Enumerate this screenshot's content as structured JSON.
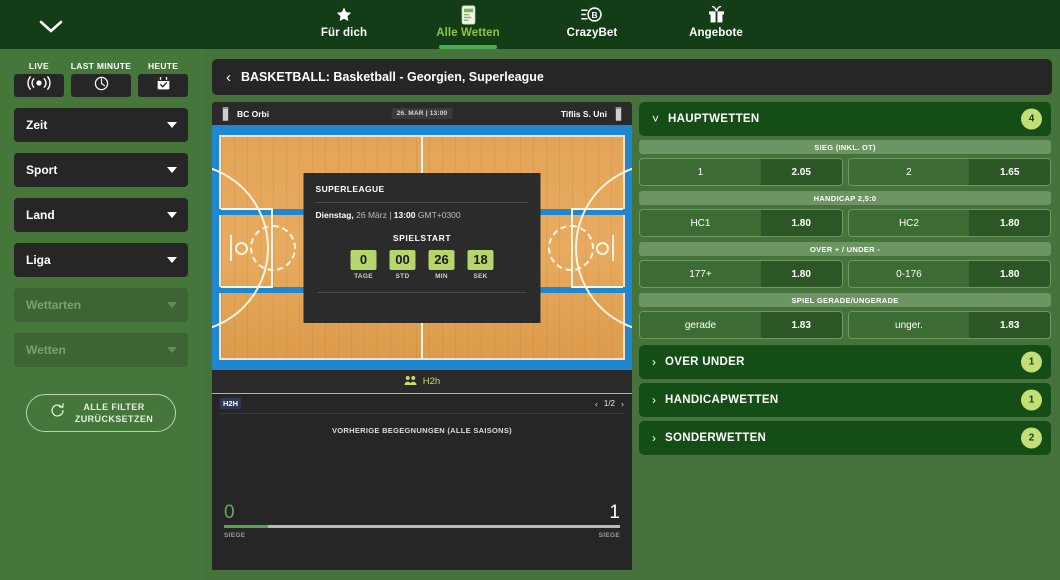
{
  "topnav": {
    "chevron_icon": "chevron-down-icon",
    "items": [
      {
        "label": "Für dich",
        "icon": "star-icon",
        "active": false
      },
      {
        "label": "Alle Wetten",
        "icon": "betslip-phone-icon",
        "active": true
      },
      {
        "label": "CrazyBet",
        "icon": "crazybet-b-icon",
        "active": false
      },
      {
        "label": "Angebote",
        "icon": "gift-icon",
        "active": false
      }
    ]
  },
  "sidebar": {
    "quick": [
      {
        "label": "LIVE",
        "icon": "live-broadcast-icon"
      },
      {
        "label": "LAST MINUTE",
        "icon": "clock-icon"
      },
      {
        "label": "HEUTE",
        "icon": "calendar-check-icon"
      }
    ],
    "filters": [
      {
        "label": "Zeit",
        "disabled": false
      },
      {
        "label": "Sport",
        "disabled": false
      },
      {
        "label": "Land",
        "disabled": false
      },
      {
        "label": "Liga",
        "disabled": false
      },
      {
        "label": "Wettarten",
        "disabled": true
      },
      {
        "label": "Wetten",
        "disabled": true
      }
    ],
    "reset": {
      "line1": "ALLE FILTER",
      "line2": "ZURÜCKSETZEN",
      "icon": "refresh-icon"
    }
  },
  "breadcrumb": {
    "back_icon": "chevron-left-icon",
    "title": "BASKETBALL: Basketball - Georgien, Superleague"
  },
  "match": {
    "home_team": "BC Orbi",
    "away_team": "Tiflis S. Uni",
    "time_badge": "26. MAR | 13:00",
    "jersey_icon": "jersey-icon"
  },
  "countdown": {
    "league": "SUPERLEAGUE",
    "date_day": "Dienstag,",
    "date_rest": " 26 März | ",
    "date_time": "13:00",
    "date_tz": " GMT+0300",
    "start_label": "SPIELSTART",
    "units": [
      {
        "value": "0",
        "label": "TAGE"
      },
      {
        "value": "00",
        "label": "STD"
      },
      {
        "value": "26",
        "label": "MIN"
      },
      {
        "value": "18",
        "label": "SEK"
      }
    ]
  },
  "h2h": {
    "tab_label": "H2h",
    "tab_icon": "people-icon",
    "tag": "H2H",
    "pager": {
      "prev_icon": "chevron-left-icon",
      "page": "1/2",
      "next_icon": "chevron-right-icon"
    },
    "subtitle": "VORHERIGE BEGEGNUNGEN (ALLE SAISONS)",
    "wins_home": "0",
    "wins_away": "1",
    "wins_label_left": "SIEGE",
    "wins_label_right": "SIEGE"
  },
  "markets": {
    "main": {
      "title": "HAUPTWETTEN",
      "count": "4",
      "chevron_icon": "chevron-down-icon",
      "groups": [
        {
          "title": "SIEG (INKL. OT)",
          "options": [
            {
              "name": "1",
              "odds": "2.05"
            },
            {
              "name": "2",
              "odds": "1.65"
            }
          ]
        },
        {
          "title": "HANDICAP 2,5:0",
          "options": [
            {
              "name": "HC1",
              "odds": "1.80"
            },
            {
              "name": "HC2",
              "odds": "1.80"
            }
          ]
        },
        {
          "title": "OVER + / UNDER -",
          "options": [
            {
              "name": "177+",
              "odds": "1.80"
            },
            {
              "name": "0-176",
              "odds": "1.80"
            }
          ]
        },
        {
          "title": "SPIEL GERADE/UNGERADE",
          "options": [
            {
              "name": "gerade",
              "odds": "1.83"
            },
            {
              "name": "unger.",
              "odds": "1.83"
            }
          ]
        }
      ]
    },
    "collapsed": [
      {
        "title": "OVER UNDER",
        "count": "1",
        "chevron_icon": "chevron-right-icon"
      },
      {
        "title": "HANDICAPWETTEN",
        "count": "1",
        "chevron_icon": "chevron-right-icon"
      },
      {
        "title": "SONDERWETTEN",
        "count": "2",
        "chevron_icon": "chevron-right-icon"
      }
    ]
  },
  "colors": {
    "brand_green": "#45763a",
    "nav_dark": "#133d16",
    "accent_lime": "#b5d66a",
    "accent_badge": "#c4de76",
    "panel_dark": "#262626",
    "court_blue": "#1f86d0",
    "court_wood": "#e3a457",
    "market_head": "#154d17"
  }
}
